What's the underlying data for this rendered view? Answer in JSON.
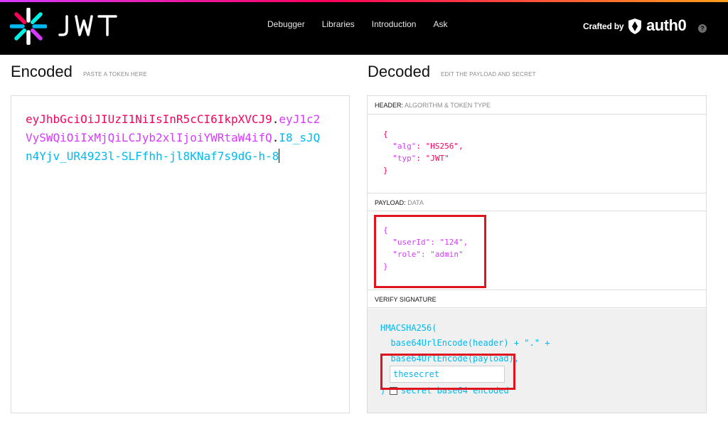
{
  "nav": {
    "logo_text": "JWT",
    "links": [
      "Debugger",
      "Libraries",
      "Introduction",
      "Ask"
    ],
    "crafted_by": "Crafted by",
    "brand": "auth0",
    "help_label": "?"
  },
  "encoded": {
    "title": "Encoded",
    "subtitle": "PASTE A TOKEN HERE",
    "token_header": "eyJhbGciOiJIUzI1NiIsInR5cCI6IkpXVCJ9",
    "token_payload": "eyJ1c2VySWQiOiIxMjQiLCJyb2xlIjoiYWRtaW4ifQ",
    "token_signature": "I8_sJQn4Yjv_UR4923l-SLFfhh-jl8KNaf7s9dG-h-8",
    "dot": "."
  },
  "decoded": {
    "title": "Decoded",
    "subtitle": "EDIT THE PAYLOAD AND SECRET",
    "header_section": {
      "label": "HEADER:",
      "muted": "ALGORITHM & TOKEN TYPE"
    },
    "header_json": {
      "open": "{",
      "alg_key": "\"alg\"",
      "alg_val": ": \"HS256\",",
      "typ_key": "\"typ\"",
      "typ_val": ": \"JWT\"",
      "close": "}"
    },
    "payload_section": {
      "label": "PAYLOAD:",
      "muted": "DATA"
    },
    "payload_json": {
      "open": "{",
      "userId_key": "\"userId\"",
      "userId_val": ": \"124\",",
      "role_key": "\"role\"",
      "role_val": ": \"admin\"",
      "close": "}"
    },
    "verify_section": {
      "label": "VERIFY SIGNATURE"
    },
    "verify": {
      "line1": "HMACSHA256(",
      "line2": "  base64UrlEncode(header) + \".\" +",
      "line3": "  base64UrlEncode(payload),",
      "secret_value": "thesecret",
      "close_paren": ")",
      "base64_label": "secret base64 encoded"
    }
  },
  "colors": {
    "header": "#fb015b",
    "payload": "#d63aff",
    "signature": "#00b9f1",
    "highlight": "#e0141e"
  }
}
